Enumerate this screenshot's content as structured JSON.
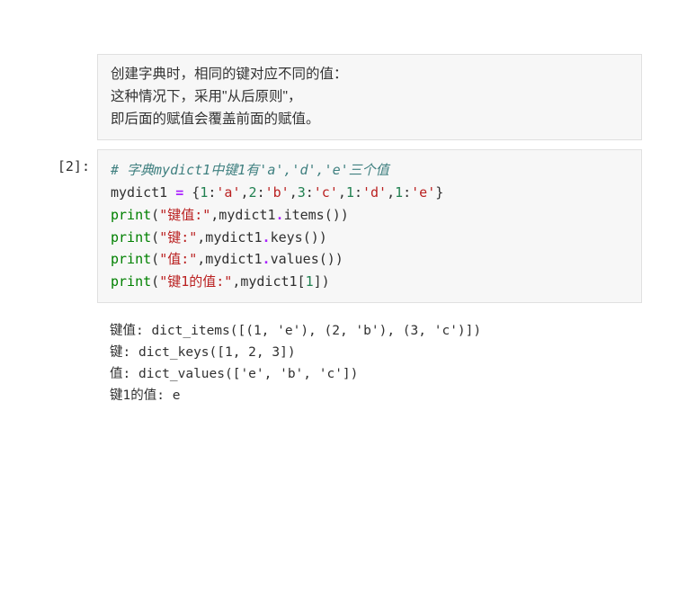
{
  "markdown": {
    "line1": "创建字典时，相同的键对应不同的值：",
    "line2": "这种情况下，采用\"从后原则\"，",
    "line3": "即后面的赋值会覆盖前面的赋值。"
  },
  "prompt": "[2]:",
  "code": {
    "l1_comment": "# 字典mydict1中键1有'a','d','e'三个值",
    "l2_var": "mydict1 ",
    "l2_eq": "=",
    "l2_sp": " {",
    "l2_n1": "1",
    "l2_c1": ":",
    "l2_s1": "'a'",
    "l2_p1": ",",
    "l2_n2": "2",
    "l2_c2": ":",
    "l2_s2": "'b'",
    "l2_p2": ",",
    "l2_n3": "3",
    "l2_c3": ":",
    "l2_s3": "'c'",
    "l2_p3": ",",
    "l2_n4": "1",
    "l2_c4": ":",
    "l2_s4": "'d'",
    "l2_p4": ",",
    "l2_n5": "1",
    "l2_c5": ":",
    "l2_s5": "'e'",
    "l2_close": "}",
    "l3_print": "print",
    "l3_open": "(",
    "l3_str": "\"键值:\"",
    "l3_mid": ",mydict1",
    "l3_dot": ".",
    "l3_meth": "items",
    "l3_end": "())",
    "l4_print": "print",
    "l4_open": "(",
    "l4_str": "\"键:\"",
    "l4_mid": ",mydict1",
    "l4_dot": ".",
    "l4_meth": "keys",
    "l4_end": "())",
    "l5_print": "print",
    "l5_open": "(",
    "l5_str": "\"值:\"",
    "l5_mid": ",mydict1",
    "l5_dot": ".",
    "l5_meth": "values",
    "l5_end": "())",
    "l6_print": "print",
    "l6_open": "(",
    "l6_str": "\"键1的值:\"",
    "l6_mid": ",mydict1[",
    "l6_idx": "1",
    "l6_end": "])"
  },
  "output": {
    "l1": "键值: dict_items([(1, 'e'), (2, 'b'), (3, 'c')])",
    "l2": "键: dict_keys([1, 2, 3])",
    "l3": "值: dict_values(['e', 'b', 'c'])",
    "l4": "键1的值: e"
  }
}
